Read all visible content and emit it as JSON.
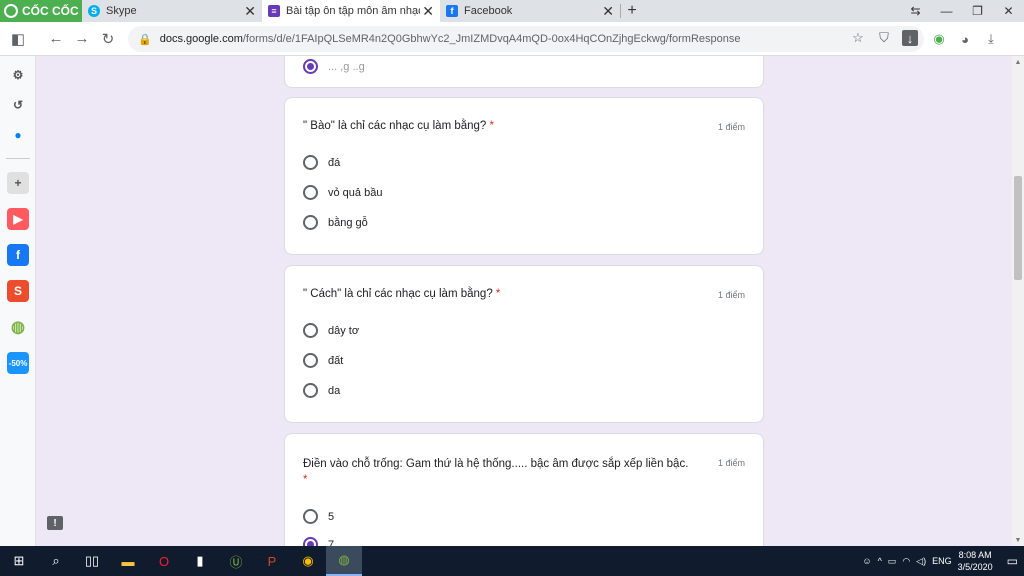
{
  "browser": {
    "brand": "CỐC CỐC",
    "tabs": [
      {
        "title": "Skype"
      },
      {
        "title": "Bài tập ôn tập môn âm nhạc lớp"
      },
      {
        "title": "Facebook"
      }
    ],
    "url_host": "docs.google.com",
    "url_path": "/forms/d/e/1FAIpQLSeMR4n2Q0GbhwYc2_JmIZMDvqA4mQD-0ox4HqCOnZjhgEckwg/formResponse"
  },
  "form": {
    "prev_card_text": "... ,g ..g",
    "questions": [
      {
        "title": "\" Bào\" là chỉ các nhạc cụ làm bằng?",
        "required": "*",
        "points": "1 điểm",
        "options": [
          "đá",
          "vỏ quả bầu",
          "bằng gỗ"
        ]
      },
      {
        "title": "\" Cách\" là chỉ các nhạc cụ làm bằng?",
        "required": "*",
        "points": "1 điểm",
        "options": [
          "dây tơ",
          "đất",
          "da"
        ]
      },
      {
        "title": "Điền vào chỗ trống: Gam thứ là hệ thống..... bậc âm được sắp xếp liền bậc.",
        "required": "*",
        "points": "1 điểm",
        "options": [
          "5",
          "7"
        ]
      }
    ]
  },
  "taskbar": {
    "lang": "ENG",
    "time": "8:08 AM",
    "date": "3/5/2020"
  },
  "colors": {
    "accent": "#673ab7",
    "background": "#ede7f6",
    "required": "#d93025",
    "brand": "#4caf50"
  }
}
